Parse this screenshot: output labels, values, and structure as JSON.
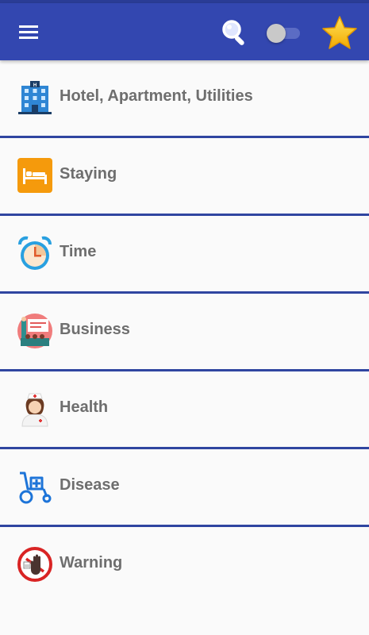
{
  "appbar": {
    "menu_icon": "hamburger-menu-icon",
    "search_icon": "search-icon",
    "toggle_state": "off",
    "favorite_icon": "star-icon",
    "primary_color": "#3347b0",
    "star_color": "#f5b800"
  },
  "categories": [
    {
      "label": "Hotel, Apartment, Utilities",
      "icon": "hotel-icon"
    },
    {
      "label": "Staying",
      "icon": "bed-icon"
    },
    {
      "label": "Time",
      "icon": "alarm-clock-icon"
    },
    {
      "label": "Business",
      "icon": "business-meeting-icon"
    },
    {
      "label": "Health",
      "icon": "nurse-icon"
    },
    {
      "label": "Disease",
      "icon": "wheelchair-icon"
    },
    {
      "label": "Warning",
      "icon": "stop-hand-icon"
    }
  ]
}
